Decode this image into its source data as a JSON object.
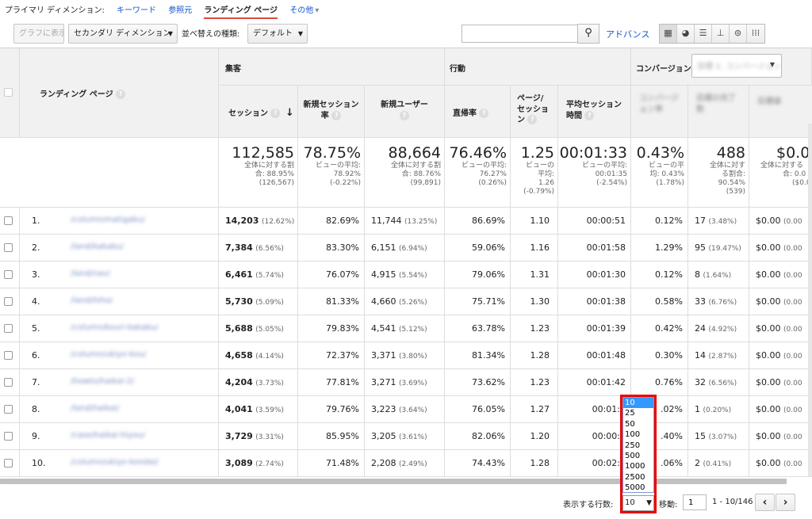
{
  "dimension_bar": {
    "label": "プライマリ ディメンション:",
    "items": [
      {
        "label": "キーワード",
        "selected": false
      },
      {
        "label": "参照元",
        "selected": false
      },
      {
        "label": "ランディング ページ",
        "selected": true
      },
      {
        "label": "その他",
        "selected": false
      }
    ],
    "other_arrow": "▾"
  },
  "toolbar": {
    "graph_button": "グラフに表示",
    "secondary_dim_button": "セカンダリ ディメンション",
    "sort_label": "並べ替えの種類:",
    "sort_value": "デフォルト",
    "search_placeholder": "",
    "advanced_link": "アドバンス",
    "search_icon": "🔍",
    "view_icons": [
      "▦",
      "◕",
      "☰",
      "⊥",
      "⊜",
      "⁞⁞⁞"
    ]
  },
  "table": {
    "col_landing": "ランディング ページ",
    "group_acquisition": "集客",
    "group_behavior": "行動",
    "group_conversion": "コンバージョン",
    "conversion_select_blurred": "目標 1: コンバージョン",
    "headers": {
      "sessions": "セッション",
      "new_session_rate": "新規セッション率",
      "new_users": "新規ユーザー",
      "bounce_rate": "直帰率",
      "pages_per_session": "ページ/セッション",
      "avg_duration": "平均セッション時間",
      "blur1": "コンバージョン率",
      "blur2": "目標の完了数",
      "blur3": "目標値"
    },
    "sort_arrow": "↓",
    "help_mark": "?",
    "totals": {
      "sessions": {
        "big": "112,585",
        "sm": [
          "全体に対する割",
          "合: 88.95%",
          "(126,567)"
        ]
      },
      "new_session_rate": {
        "big": "78.75%",
        "sm": [
          "ビューの平均:",
          "78.92%",
          "(-0.22%)"
        ]
      },
      "new_users": {
        "big": "88,664",
        "sm": [
          "全体に対する割",
          "合: 88.76%",
          "(99,891)"
        ]
      },
      "bounce_rate": {
        "big": "76.46%",
        "sm": [
          "ビューの平均:",
          "76.27%",
          "(0.26%)"
        ]
      },
      "pages_per_session": {
        "big": "1.25",
        "sm": [
          "ビューの",
          "平均:",
          "1.26",
          "(-0.79%)"
        ]
      },
      "avg_duration": {
        "big": "00:01:33",
        "sm": [
          "ビューの平均:",
          "00:01:35",
          "(-2.54%)"
        ]
      },
      "conv_rate": {
        "big": "0.43%",
        "sm": [
          "ビューの平",
          "均: 0.43%",
          "(1.78%)"
        ]
      },
      "goal_completions": {
        "big": "488",
        "sm": [
          "全体に対す",
          "る割合:",
          "90.54%",
          "(539)"
        ]
      },
      "goal_value": {
        "big": "$0.0",
        "sm": [
          "全体に対する",
          "合: 0.0",
          "($0.0"
        ]
      }
    },
    "rows": [
      {
        "num": "1.",
        "page": "/column/matigaku/",
        "sessions": "14,203",
        "sessions_pct": "(12.62%)",
        "nsr": "82.69%",
        "new_users": "11,744",
        "nu_pct": "(13.25%)",
        "bounce": "86.69%",
        "pps": "1.10",
        "dur": "00:00:51",
        "cr": "0.12%",
        "gc": "17",
        "gc_pct": "(3.48%)",
        "gv": "$0.00",
        "gv_pct": "(0.00"
      },
      {
        "num": "2.",
        "page": "/land/kakaku/",
        "sessions": "7,384",
        "sessions_pct": "(6.56%)",
        "nsr": "83.30%",
        "new_users": "6,151",
        "nu_pct": "(6.94%)",
        "bounce": "59.06%",
        "pps": "1.16",
        "dur": "00:01:58",
        "cr": "1.29%",
        "gc": "95",
        "gc_pct": "(19.47%)",
        "gv": "$0.00",
        "gv_pct": "(0.00"
      },
      {
        "num": "3.",
        "page": "/land/nav/",
        "sessions": "6,461",
        "sessions_pct": "(5.74%)",
        "nsr": "76.07%",
        "new_users": "4,915",
        "nu_pct": "(5.54%)",
        "bounce": "79.06%",
        "pps": "1.31",
        "dur": "00:01:30",
        "cr": "0.12%",
        "gc": "8",
        "gc_pct": "(1.64%)",
        "gv": "$0.00",
        "gv_pct": "(0.00"
      },
      {
        "num": "4.",
        "page": "/land/hiho/",
        "sessions": "5,730",
        "sessions_pct": "(5.09%)",
        "nsr": "81.33%",
        "new_users": "4,660",
        "nu_pct": "(5.26%)",
        "bounce": "75.71%",
        "pps": "1.30",
        "dur": "00:01:38",
        "cr": "0.58%",
        "gc": "33",
        "gc_pct": "(6.76%)",
        "gv": "$0.00",
        "gv_pct": "(0.00"
      },
      {
        "num": "5.",
        "page": "/column/kouri-kakaku/",
        "sessions": "5,688",
        "sessions_pct": "(5.05%)",
        "nsr": "79.83%",
        "new_users": "4,541",
        "nu_pct": "(5.12%)",
        "bounce": "63.78%",
        "pps": "1.23",
        "dur": "00:01:39",
        "cr": "0.42%",
        "gc": "24",
        "gc_pct": "(4.92%)",
        "gv": "$0.00",
        "gv_pct": "(0.00"
      },
      {
        "num": "6.",
        "page": "/column/ukiyo-kou/",
        "sessions": "4,658",
        "sessions_pct": "(4.14%)",
        "nsr": "72.37%",
        "new_users": "3,371",
        "nu_pct": "(3.80%)",
        "bounce": "81.34%",
        "pps": "1.28",
        "dur": "00:01:48",
        "cr": "0.30%",
        "gc": "14",
        "gc_pct": "(2.87%)",
        "gv": "$0.00",
        "gv_pct": "(0.00"
      },
      {
        "num": "7.",
        "page": "/howto/haikai-2/",
        "sessions": "4,204",
        "sessions_pct": "(3.73%)",
        "nsr": "77.81%",
        "new_users": "3,271",
        "nu_pct": "(3.69%)",
        "bounce": "73.62%",
        "pps": "1.23",
        "dur": "00:01:42",
        "cr": "0.76%",
        "gc": "32",
        "gc_pct": "(6.56%)",
        "gv": "$0.00",
        "gv_pct": "(0.00"
      },
      {
        "num": "8.",
        "page": "/land/haikai/",
        "sessions": "4,041",
        "sessions_pct": "(3.59%)",
        "nsr": "79.76%",
        "new_users": "3,223",
        "nu_pct": "(3.64%)",
        "bounce": "76.05%",
        "pps": "1.27",
        "dur": "00:01:4",
        "cr": ".02%",
        "gc": "1",
        "gc_pct": "(0.20%)",
        "gv": "$0.00",
        "gv_pct": "(0.00"
      },
      {
        "num": "9.",
        "page": "/case/haikai-hiyou/",
        "sessions": "3,729",
        "sessions_pct": "(3.31%)",
        "nsr": "85.95%",
        "new_users": "3,205",
        "nu_pct": "(3.61%)",
        "bounce": "82.06%",
        "pps": "1.20",
        "dur": "00:00:5",
        "cr": ".40%",
        "gc": "15",
        "gc_pct": "(3.07%)",
        "gv": "$0.00",
        "gv_pct": "(0.00"
      },
      {
        "num": "10.",
        "page": "/column/ukiyo-kondai/",
        "sessions": "3,089",
        "sessions_pct": "(2.74%)",
        "nsr": "71.48%",
        "new_users": "2,208",
        "nu_pct": "(2.49%)",
        "bounce": "74.43%",
        "pps": "1.28",
        "dur": "00:02:2",
        "cr": ".06%",
        "gc": "2",
        "gc_pct": "(0.41%)",
        "gv": "$0.00",
        "gv_pct": "(0.00"
      }
    ]
  },
  "footer": {
    "rows_label": "表示する行数:",
    "rows_value": "10",
    "goto_label": "移動:",
    "goto_value": "1",
    "range": "1 - 10/146",
    "prev": "‹",
    "next": "›"
  },
  "rows_dropdown": {
    "options": [
      "10",
      "25",
      "50",
      "100",
      "250",
      "500",
      "1000",
      "2500",
      "5000"
    ],
    "selected": "10",
    "highlight_color": "#3399ff",
    "frame_color": "#e00000"
  }
}
